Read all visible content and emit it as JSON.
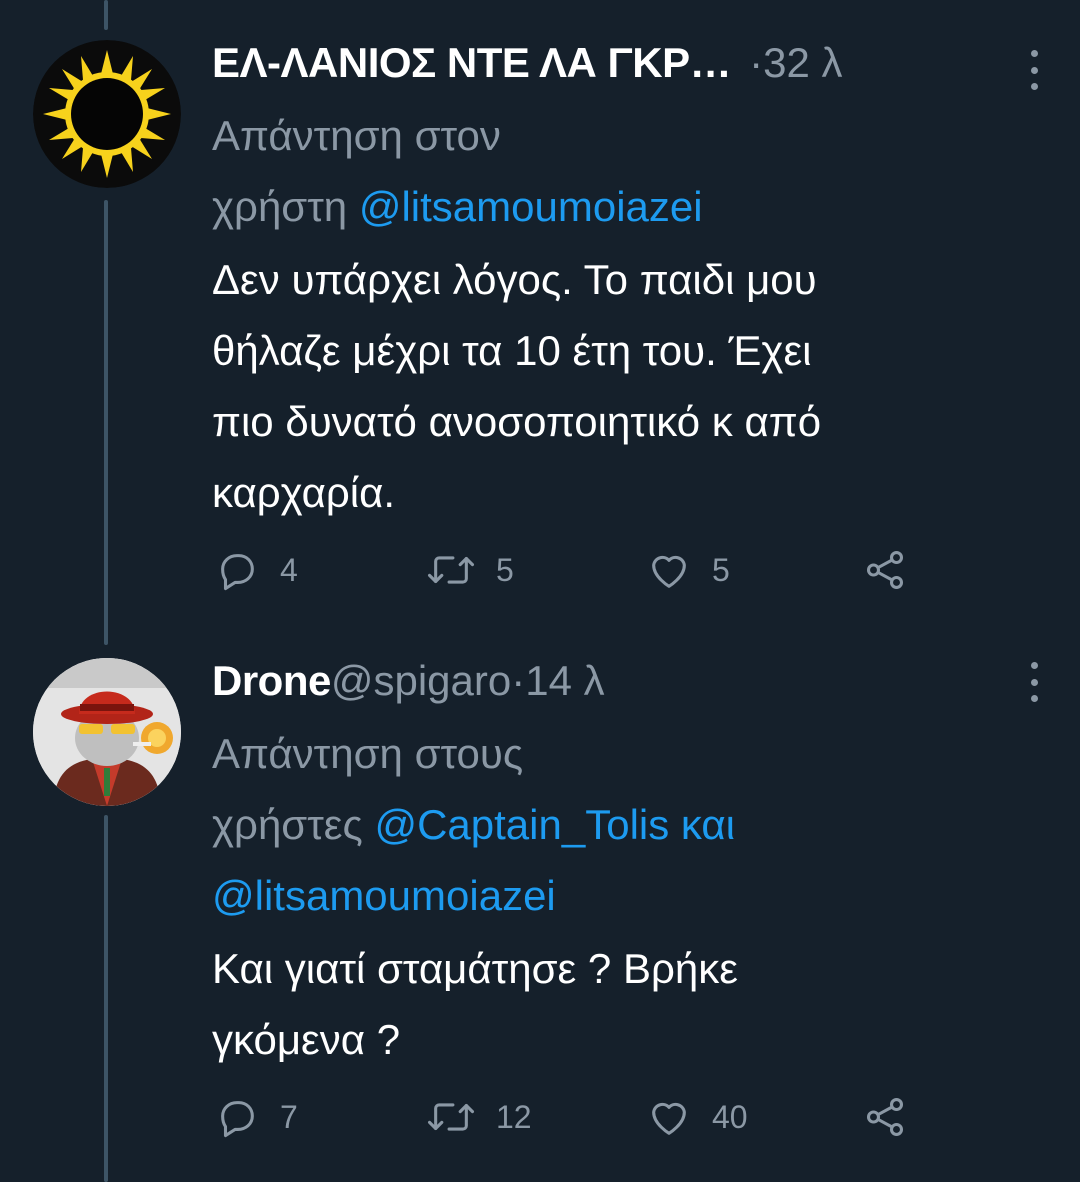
{
  "tweets": [
    {
      "display_name": "ΕΛ-ΛΑΝΙΟΣ ΝΤΕ ΛΑ ΓΚΡ…",
      "handle": "",
      "separator": " · ",
      "time": "32 λ",
      "reply_prefix_1": "Απάντηση στον",
      "reply_prefix_2": "χρήστη ",
      "mention_1": "@litsamoumoiazei",
      "mention_2": "",
      "body_lines": [
        "Δεν υπάρχει λόγος. Το παιδι μου",
        "θήλαζε μέχρι τα 10 έτη του. Έχει",
        "πιο δυνατό ανοσοποιητικό κ από",
        "καρχαρία."
      ],
      "replies": "4",
      "retweets": "5",
      "likes": "5"
    },
    {
      "display_name": "Drone",
      "handle": " @spigaro",
      "separator": " · ",
      "time": "14 λ",
      "reply_prefix_1": "Απάντηση στους",
      "reply_prefix_2": "χρήστες ",
      "mention_1": "@Captain_Tolis",
      "mention_joiner": " και",
      "mention_2": "@litsamoumoiazei",
      "body_lines": [
        "Και γιατί σταμάτησε ? Βρήκε",
        "γκόμενα ?"
      ],
      "replies": "7",
      "retweets": "12",
      "likes": "40"
    }
  ],
  "icons": {
    "reply": "reply-icon",
    "retweet": "retweet-icon",
    "like": "heart-icon",
    "share": "share-icon",
    "more": "more-icon"
  },
  "colors": {
    "background": "#15202b",
    "muted": "#8b98a5",
    "mention": "#1d9bf0",
    "thread_line": "#3d5466"
  }
}
